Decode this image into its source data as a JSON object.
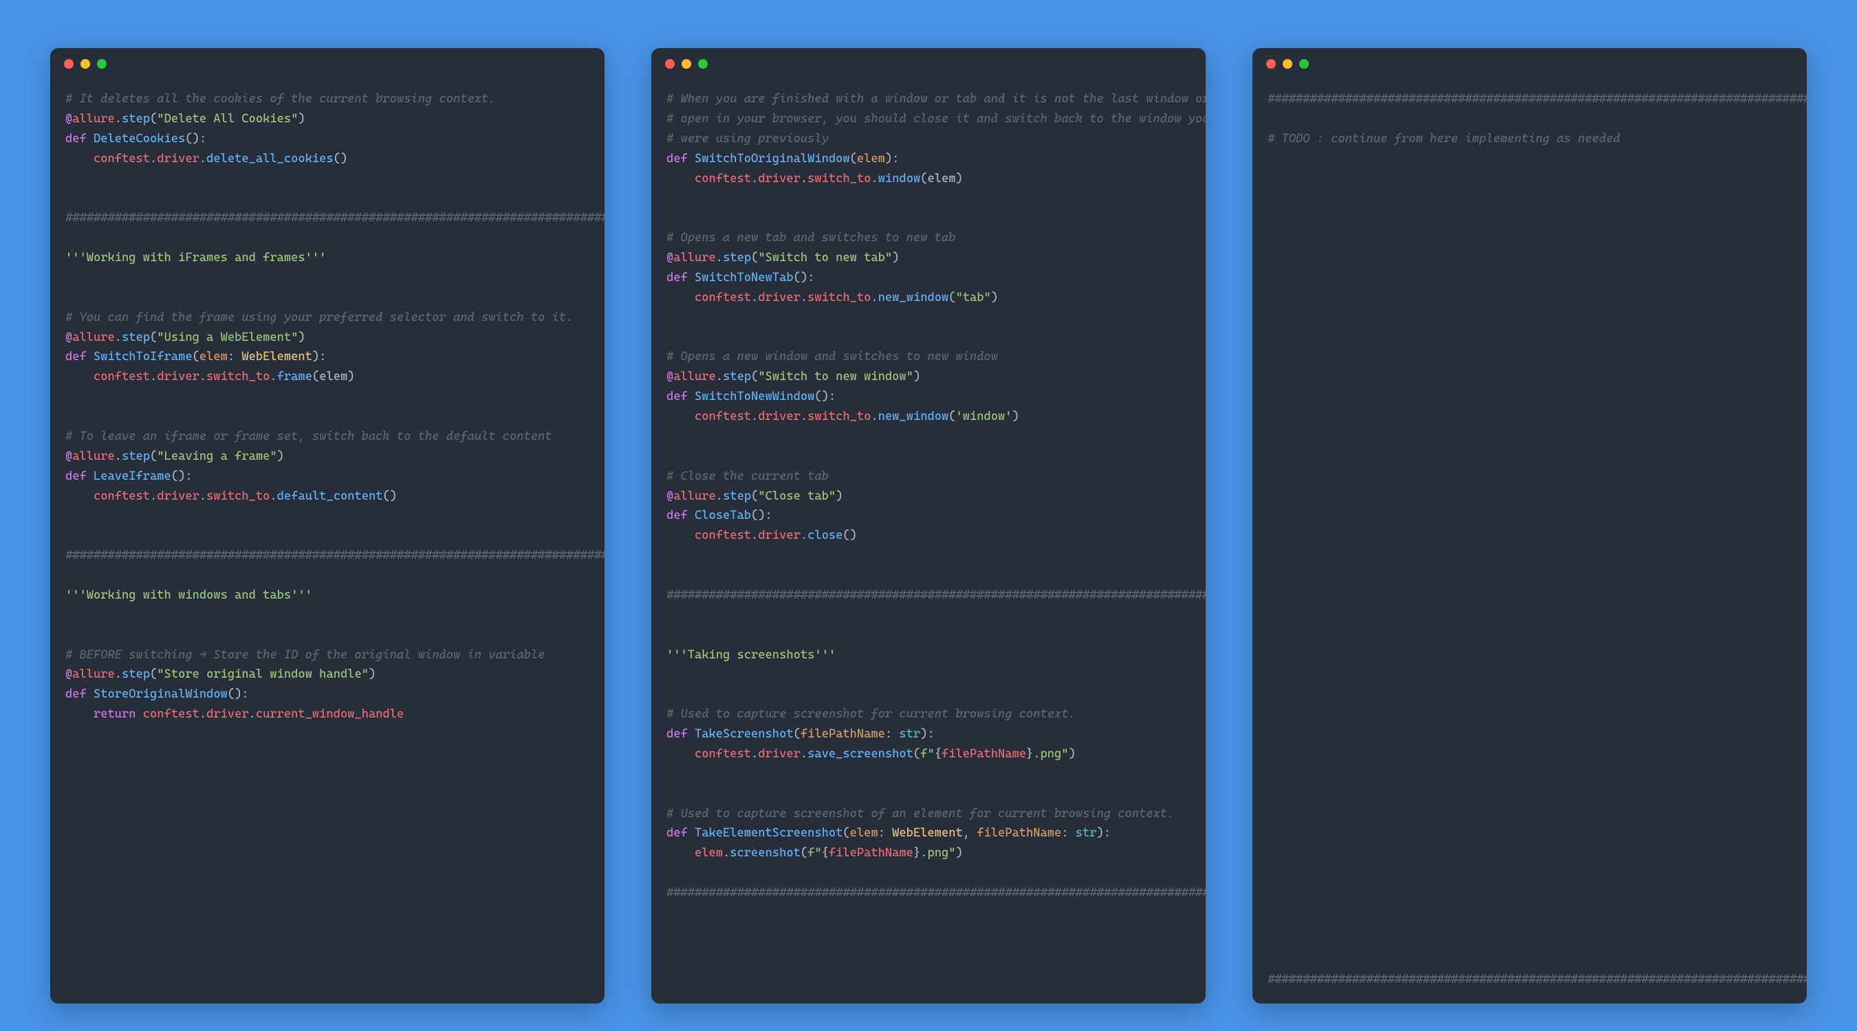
{
  "colors": {
    "page_bg": "#4993e6",
    "editor_bg": "#282d3a",
    "comment": "#5c6370",
    "string": "#98c379",
    "keyword": "#c678dd",
    "function": "#61afef",
    "ident": "#e06c75",
    "type": "#e5c07b",
    "param": "#d19a66",
    "builtin": "#56b6c2"
  },
  "windows": [
    {
      "id": "left",
      "lines": [
        [
          "comment",
          "# It deletes all the cookies of the current browsing context."
        ],
        [
          "decorator",
          {
            "at": "@",
            "obj": "allure",
            "dot": ".",
            "fn": "step",
            "open": "(",
            "str": "\"Delete All Cookies\"",
            "close": ")"
          }
        ],
        [
          "funcdef",
          {
            "def": "def ",
            "name": "DeleteCookies",
            "sig": "():"
          }
        ],
        [
          "body",
          {
            "indent": "    ",
            "parts": [
              [
                "ident",
                "conftest"
              ],
              [
                "dot",
                "."
              ],
              [
                "ident",
                "driver"
              ],
              [
                "dot",
                "."
              ],
              [
                "fn",
                "delete_all_cookies"
              ],
              [
                "punct",
                "()"
              ]
            ]
          }
        ],
        [
          "blank",
          ""
        ],
        [
          "blank",
          ""
        ],
        [
          "comment",
          "#############################################################################"
        ],
        [
          "blank",
          ""
        ],
        [
          "string",
          "'''Working with iFrames and frames'''"
        ],
        [
          "blank",
          ""
        ],
        [
          "blank",
          ""
        ],
        [
          "comment",
          "# You can find the frame using your preferred selector and switch to it."
        ],
        [
          "decorator",
          {
            "at": "@",
            "obj": "allure",
            "dot": ".",
            "fn": "step",
            "open": "(",
            "str": "\"Using a WebElement\"",
            "close": ")"
          }
        ],
        [
          "funcdef",
          {
            "def": "def ",
            "name": "SwitchToIframe",
            "sig": "(",
            "params": [
              [
                "param",
                "elem"
              ],
              [
                "punct",
                ": "
              ],
              [
                "type",
                "WebElement"
              ]
            ],
            "close": "):"
          }
        ],
        [
          "body",
          {
            "indent": "    ",
            "parts": [
              [
                "ident",
                "conftest"
              ],
              [
                "dot",
                "."
              ],
              [
                "ident",
                "driver"
              ],
              [
                "dot",
                "."
              ],
              [
                "ident",
                "switch_to"
              ],
              [
                "dot",
                "."
              ],
              [
                "fn",
                "frame"
              ],
              [
                "punct",
                "("
              ],
              [
                "var",
                "elem"
              ],
              [
                "punct",
                ")"
              ]
            ]
          }
        ],
        [
          "blank",
          ""
        ],
        [
          "blank",
          ""
        ],
        [
          "comment",
          "# To leave an iframe or frame set, switch back to the default content"
        ],
        [
          "decorator",
          {
            "at": "@",
            "obj": "allure",
            "dot": ".",
            "fn": "step",
            "open": "(",
            "str": "\"Leaving a frame\"",
            "close": ")"
          }
        ],
        [
          "funcdef",
          {
            "def": "def ",
            "name": "LeaveIframe",
            "sig": "():"
          }
        ],
        [
          "body",
          {
            "indent": "    ",
            "parts": [
              [
                "ident",
                "conftest"
              ],
              [
                "dot",
                "."
              ],
              [
                "ident",
                "driver"
              ],
              [
                "dot",
                "."
              ],
              [
                "ident",
                "switch_to"
              ],
              [
                "dot",
                "."
              ],
              [
                "fn",
                "default_content"
              ],
              [
                "punct",
                "()"
              ]
            ]
          }
        ],
        [
          "blank",
          ""
        ],
        [
          "blank",
          ""
        ],
        [
          "comment",
          "#############################################################################"
        ],
        [
          "blank",
          ""
        ],
        [
          "string",
          "'''Working with windows and tabs'''"
        ],
        [
          "blank",
          ""
        ],
        [
          "blank",
          ""
        ],
        [
          "comment",
          "# BEFORE switching → Store the ID of the original window in variable"
        ],
        [
          "decorator",
          {
            "at": "@",
            "obj": "allure",
            "dot": ".",
            "fn": "step",
            "open": "(",
            "str": "\"Store original window handle\"",
            "close": ")"
          }
        ],
        [
          "funcdef",
          {
            "def": "def ",
            "name": "StoreOriginalWindow",
            "sig": "():"
          }
        ],
        [
          "body",
          {
            "indent": "    ",
            "parts": [
              [
                "keyword",
                "return "
              ],
              [
                "ident",
                "conftest"
              ],
              [
                "dot",
                "."
              ],
              [
                "ident",
                "driver"
              ],
              [
                "dot",
                "."
              ],
              [
                "ident",
                "current_window_handle"
              ]
            ]
          }
        ]
      ]
    },
    {
      "id": "middle",
      "lines": [
        [
          "comment",
          "# When you are finished with a window or tab and it is not the last window or tab"
        ],
        [
          "comment",
          "# open in your browser, you should close it and switch back to the window you"
        ],
        [
          "comment",
          "# were using previously"
        ],
        [
          "funcdef",
          {
            "def": "def ",
            "name": "SwitchToOriginalWindow",
            "sig": "(",
            "params": [
              [
                "param",
                "elem"
              ]
            ],
            "close": "):"
          }
        ],
        [
          "body",
          {
            "indent": "    ",
            "parts": [
              [
                "ident",
                "conftest"
              ],
              [
                "dot",
                "."
              ],
              [
                "ident",
                "driver"
              ],
              [
                "dot",
                "."
              ],
              [
                "ident",
                "switch_to"
              ],
              [
                "dot",
                "."
              ],
              [
                "fn",
                "window"
              ],
              [
                "punct",
                "("
              ],
              [
                "var",
                "elem"
              ],
              [
                "punct",
                ")"
              ]
            ]
          }
        ],
        [
          "blank",
          ""
        ],
        [
          "blank",
          ""
        ],
        [
          "comment",
          "# Opens a new tab and switches to new tab"
        ],
        [
          "decorator",
          {
            "at": "@",
            "obj": "allure",
            "dot": ".",
            "fn": "step",
            "open": "(",
            "str": "\"Switch to new tab\"",
            "close": ")"
          }
        ],
        [
          "funcdef",
          {
            "def": "def ",
            "name": "SwitchToNewTab",
            "sig": "():"
          }
        ],
        [
          "body",
          {
            "indent": "    ",
            "parts": [
              [
                "ident",
                "conftest"
              ],
              [
                "dot",
                "."
              ],
              [
                "ident",
                "driver"
              ],
              [
                "dot",
                "."
              ],
              [
                "ident",
                "switch_to"
              ],
              [
                "dot",
                "."
              ],
              [
                "fn",
                "new_window"
              ],
              [
                "punct",
                "("
              ],
              [
                "string",
                "\"tab\""
              ],
              [
                "punct",
                ")"
              ]
            ]
          }
        ],
        [
          "blank",
          ""
        ],
        [
          "blank",
          ""
        ],
        [
          "comment",
          "# Opens a new window and switches to new window"
        ],
        [
          "decorator",
          {
            "at": "@",
            "obj": "allure",
            "dot": ".",
            "fn": "step",
            "open": "(",
            "str": "\"Switch to new window\"",
            "close": ")"
          }
        ],
        [
          "funcdef",
          {
            "def": "def ",
            "name": "SwitchToNewWindow",
            "sig": "():"
          }
        ],
        [
          "body",
          {
            "indent": "    ",
            "parts": [
              [
                "ident",
                "conftest"
              ],
              [
                "dot",
                "."
              ],
              [
                "ident",
                "driver"
              ],
              [
                "dot",
                "."
              ],
              [
                "ident",
                "switch_to"
              ],
              [
                "dot",
                "."
              ],
              [
                "fn",
                "new_window"
              ],
              [
                "punct",
                "("
              ],
              [
                "string",
                "'window'"
              ],
              [
                "punct",
                ")"
              ]
            ]
          }
        ],
        [
          "blank",
          ""
        ],
        [
          "blank",
          ""
        ],
        [
          "comment",
          "# Close the current tab"
        ],
        [
          "decorator",
          {
            "at": "@",
            "obj": "allure",
            "dot": ".",
            "fn": "step",
            "open": "(",
            "str": "\"Close tab\"",
            "close": ")"
          }
        ],
        [
          "funcdef",
          {
            "def": "def ",
            "name": "CloseTab",
            "sig": "():"
          }
        ],
        [
          "body",
          {
            "indent": "    ",
            "parts": [
              [
                "ident",
                "conftest"
              ],
              [
                "dot",
                "."
              ],
              [
                "ident",
                "driver"
              ],
              [
                "dot",
                "."
              ],
              [
                "fn",
                "close"
              ],
              [
                "punct",
                "()"
              ]
            ]
          }
        ],
        [
          "blank",
          ""
        ],
        [
          "blank",
          ""
        ],
        [
          "comment",
          "#############################################################################"
        ],
        [
          "blank",
          ""
        ],
        [
          "blank",
          ""
        ],
        [
          "string",
          "'''Taking screenshots'''"
        ],
        [
          "blank",
          ""
        ],
        [
          "blank",
          ""
        ],
        [
          "comment",
          "# Used to capture screenshot for current browsing context."
        ],
        [
          "funcdef",
          {
            "def": "def ",
            "name": "TakeScreenshot",
            "sig": "(",
            "params": [
              [
                "param",
                "filePathName"
              ],
              [
                "punct",
                ": "
              ],
              [
                "builtin",
                "str"
              ]
            ],
            "close": "):"
          }
        ],
        [
          "body",
          {
            "indent": "    ",
            "parts": [
              [
                "ident",
                "conftest"
              ],
              [
                "dot",
                "."
              ],
              [
                "ident",
                "driver"
              ],
              [
                "dot",
                "."
              ],
              [
                "fn",
                "save_screenshot"
              ],
              [
                "punct",
                "("
              ],
              [
                "fstr",
                "f\""
              ],
              [
                "fexpr_open",
                "{"
              ],
              [
                "fexpr",
                "filePathName"
              ],
              [
                "fexpr_close",
                "}"
              ],
              [
                "fstr",
                ".png\""
              ],
              [
                "punct",
                ")"
              ]
            ]
          }
        ],
        [
          "blank",
          ""
        ],
        [
          "blank",
          ""
        ],
        [
          "comment",
          "# Used to capture screenshot of an element for current browsing context."
        ],
        [
          "funcdef",
          {
            "def": "def ",
            "name": "TakeElementScreenshot",
            "sig": "(",
            "params": [
              [
                "param",
                "elem"
              ],
              [
                "punct",
                ": "
              ],
              [
                "type",
                "WebElement"
              ],
              [
                "punct",
                ", "
              ],
              [
                "param",
                "filePathName"
              ],
              [
                "punct",
                ": "
              ],
              [
                "builtin",
                "str"
              ]
            ],
            "close": "):"
          }
        ],
        [
          "body",
          {
            "indent": "    ",
            "parts": [
              [
                "ident",
                "elem"
              ],
              [
                "dot",
                "."
              ],
              [
                "fn",
                "screenshot"
              ],
              [
                "punct",
                "("
              ],
              [
                "fstr",
                "f\""
              ],
              [
                "fexpr_open",
                "{"
              ],
              [
                "fexpr",
                "filePathName"
              ],
              [
                "fexpr_close",
                "}"
              ],
              [
                "fstr",
                ".png\""
              ],
              [
                "punct",
                ")"
              ]
            ]
          }
        ],
        [
          "blank",
          ""
        ],
        [
          "comment",
          "#############################################################################"
        ]
      ]
    },
    {
      "id": "right",
      "lines": [
        [
          "comment",
          "#############################################################################"
        ],
        [
          "blank",
          ""
        ],
        [
          "comment",
          "# TODO : continue from here implementing as needed"
        ]
      ],
      "trailing_divider": "#############################################################################"
    }
  ]
}
